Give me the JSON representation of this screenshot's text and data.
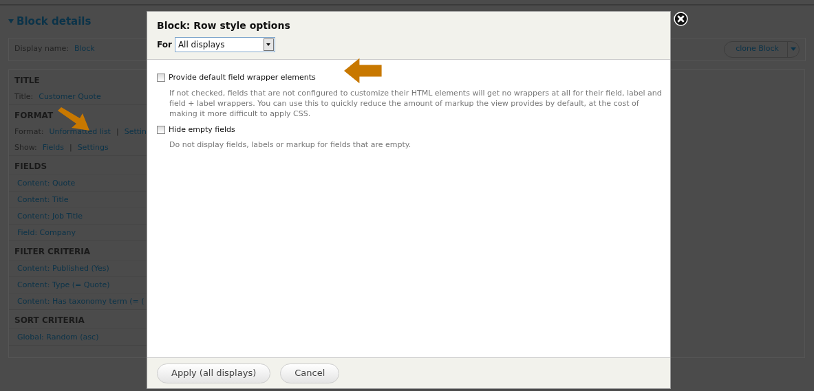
{
  "page": {
    "section_title": "Block details",
    "display_name": {
      "label": "Display name:",
      "value": "Block"
    },
    "clone_button": "clone Block",
    "sections": [
      {
        "heading": "TITLE",
        "rows": [
          {
            "label": "Title:",
            "links": [
              "Customer Quote"
            ]
          }
        ]
      },
      {
        "heading": "FORMAT",
        "rows": [
          {
            "label": "Format:",
            "links": [
              "Unformatted list",
              "Settin"
            ]
          },
          {
            "label": "Show:",
            "links": [
              "Fields",
              "Settings"
            ]
          }
        ]
      },
      {
        "heading": "FIELDS",
        "items": [
          "Content: Quote",
          "Content: Title",
          "Content: Job Title",
          "Field: Company"
        ]
      },
      {
        "heading": "FILTER CRITERIA",
        "items": [
          "Content: Published (Yes)",
          "Content: Type (= Quote)",
          "Content: Has taxonomy term (= ("
        ]
      },
      {
        "heading": "SORT CRITERIA",
        "items": [
          "Global: Random (asc)"
        ]
      }
    ],
    "separator": "|"
  },
  "dialog": {
    "title": "Block: Row style options",
    "for_label": "For",
    "select_value": "All displays",
    "options": [
      {
        "label": "Provide default field wrapper elements",
        "checked": false,
        "description": "If not checked, fields that are not configured to customize their HTML elements will get no wrappers at all for their field, label and field + label wrappers. You can use this to quickly reduce the amount of markup the view provides by default, at the cost of making it more difficult to apply CSS."
      },
      {
        "label": "Hide empty fields",
        "checked": false,
        "description": "Do not display fields, labels or markup for fields that are empty."
      }
    ],
    "buttons": [
      {
        "label": "Apply (all displays)"
      },
      {
        "label": "Cancel"
      }
    ]
  }
}
